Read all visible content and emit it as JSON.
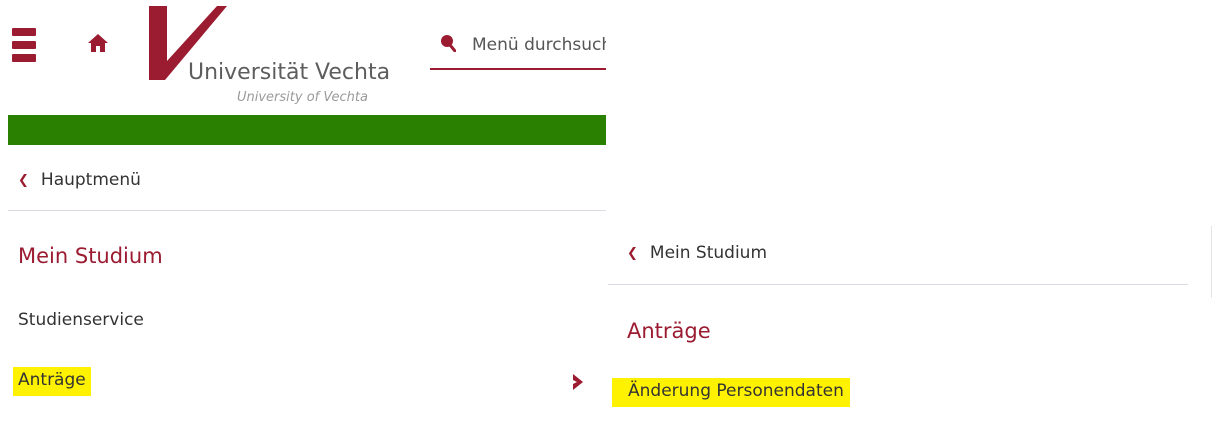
{
  "header": {
    "menu_icon": "hamburger-icon",
    "home_icon": "home-icon",
    "logo": {
      "title": "Universität Vechta",
      "subtitle": "University of Vechta",
      "mark_color": "#9b1b30"
    },
    "search": {
      "icon": "search-icon",
      "placeholder": "Menü durchsuchen",
      "value": ""
    },
    "bar_color": "#2a8000"
  },
  "main_menu": {
    "back_label": "Hauptmenü",
    "title": "Mein Studium",
    "items": [
      {
        "label": "Studienservice",
        "highlighted": false
      },
      {
        "label": "Anträge",
        "highlighted": true,
        "has_submenu": true
      }
    ]
  },
  "sub_menu": {
    "back_label": "Mein Studium",
    "title": "Anträge",
    "items": [
      {
        "label": "Änderung Personendaten",
        "highlighted": true
      }
    ]
  },
  "colors": {
    "accent": "#9b1b30",
    "highlight": "#fff200",
    "text": "#333333"
  }
}
